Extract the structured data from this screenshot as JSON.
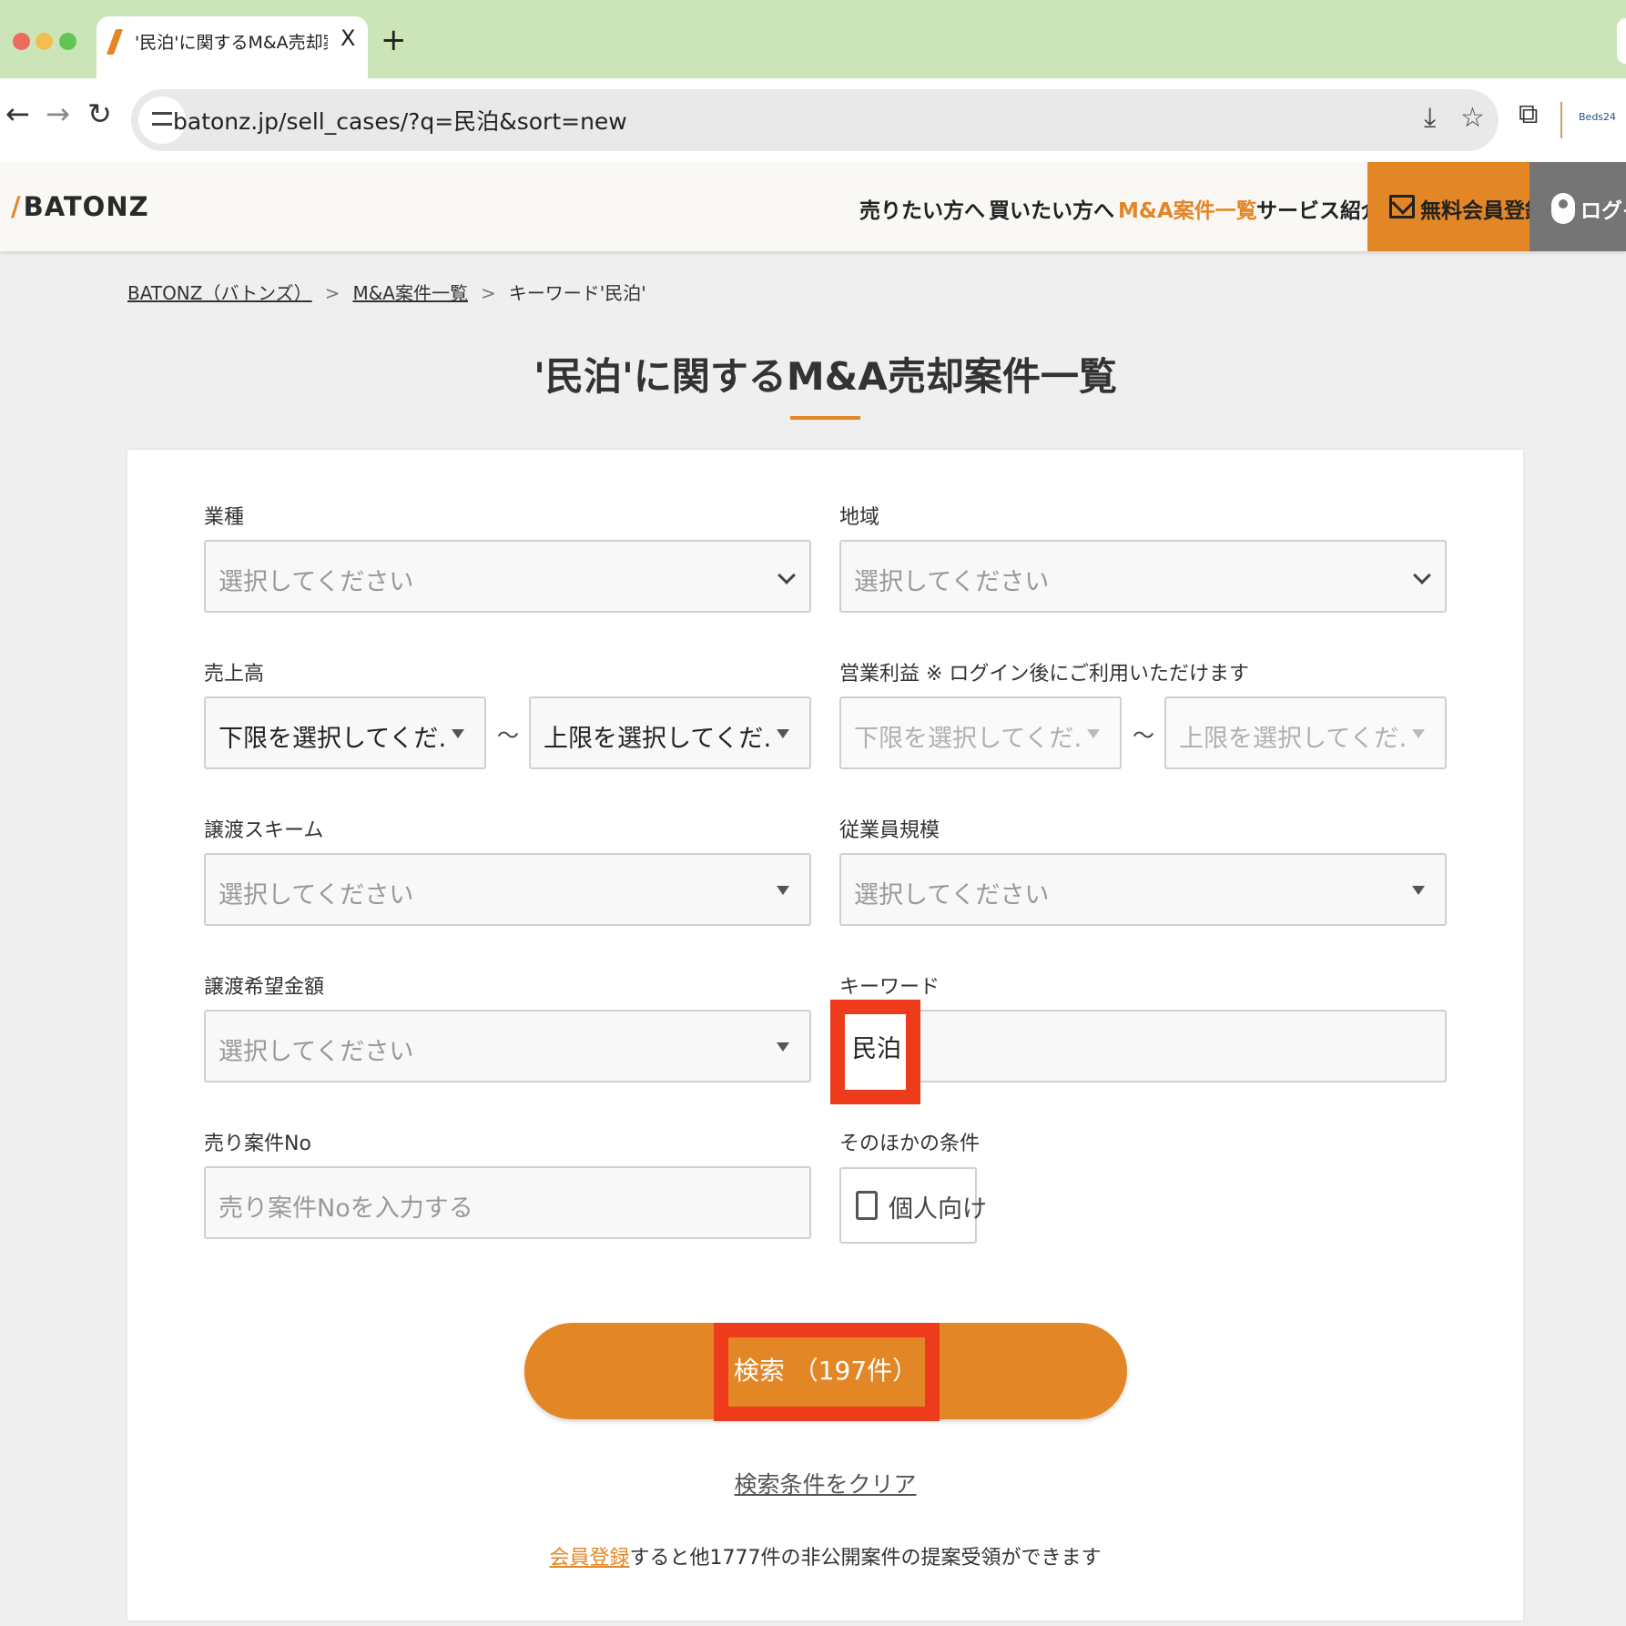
{
  "browser": {
    "tab_title": "'民泊'に関するM&A売却案件一覧",
    "tab_close": "X",
    "new_tab": "+",
    "url": "batonz.jp/sell_cases/?q=民泊&sort=new",
    "profile_label": "Beds24",
    "back_icon": "←",
    "forward_icon": "→",
    "reload_icon": "↻",
    "install_icon": "⤓",
    "star_icon": "☆",
    "extensions_icon": "⧉"
  },
  "header": {
    "logo_slash": "/",
    "logo": "BATONZ",
    "nav": [
      "売りたい方へ",
      "買いたい方へ",
      "M&A案件一覧",
      "サービス紹介"
    ],
    "register": "無料会員登録",
    "login": "ログイン"
  },
  "breadcrumb": {
    "home": "BATONZ（バトンズ）",
    "list": "M&A案件一覧",
    "current": "キーワード'民泊'",
    "sep": ">"
  },
  "page_title": "'民泊'に関するM&A売却案件一覧",
  "form": {
    "industry": {
      "label": "業種",
      "placeholder": "選択してください"
    },
    "region": {
      "label": "地域",
      "placeholder": "選択してください"
    },
    "sales": {
      "label": "売上高",
      "min": "下限を選択してくだ…",
      "max": "上限を選択してくだ…"
    },
    "profit": {
      "label": "営業利益 ※ ログイン後にご利用いただけます",
      "min": "下限を選択してくだ…",
      "max": "上限を選択してくだ…"
    },
    "tilde": "～",
    "scheme": {
      "label": "譲渡スキーム",
      "placeholder": "選択してください"
    },
    "employees": {
      "label": "従業員規模",
      "placeholder": "選択してください"
    },
    "price": {
      "label": "譲渡希望金額",
      "placeholder": "選択してください"
    },
    "keyword": {
      "label": "キーワード",
      "value": "民泊"
    },
    "case_no": {
      "label": "売り案件No",
      "placeholder": "売り案件Noを入力する"
    },
    "other": {
      "label": "そのほかの条件",
      "checkbox": "個人向け",
      "checked": false
    },
    "search_button": "検索 （197件）",
    "clear": "検索条件をクリア",
    "footnote_link": "会員登録",
    "footnote_rest": "すると他1777件の非公開案件の提案受領ができます"
  },
  "colors": {
    "accent": "#e38625",
    "highlight": "#ee3b1c",
    "tabbar": "#cbe5b9"
  }
}
